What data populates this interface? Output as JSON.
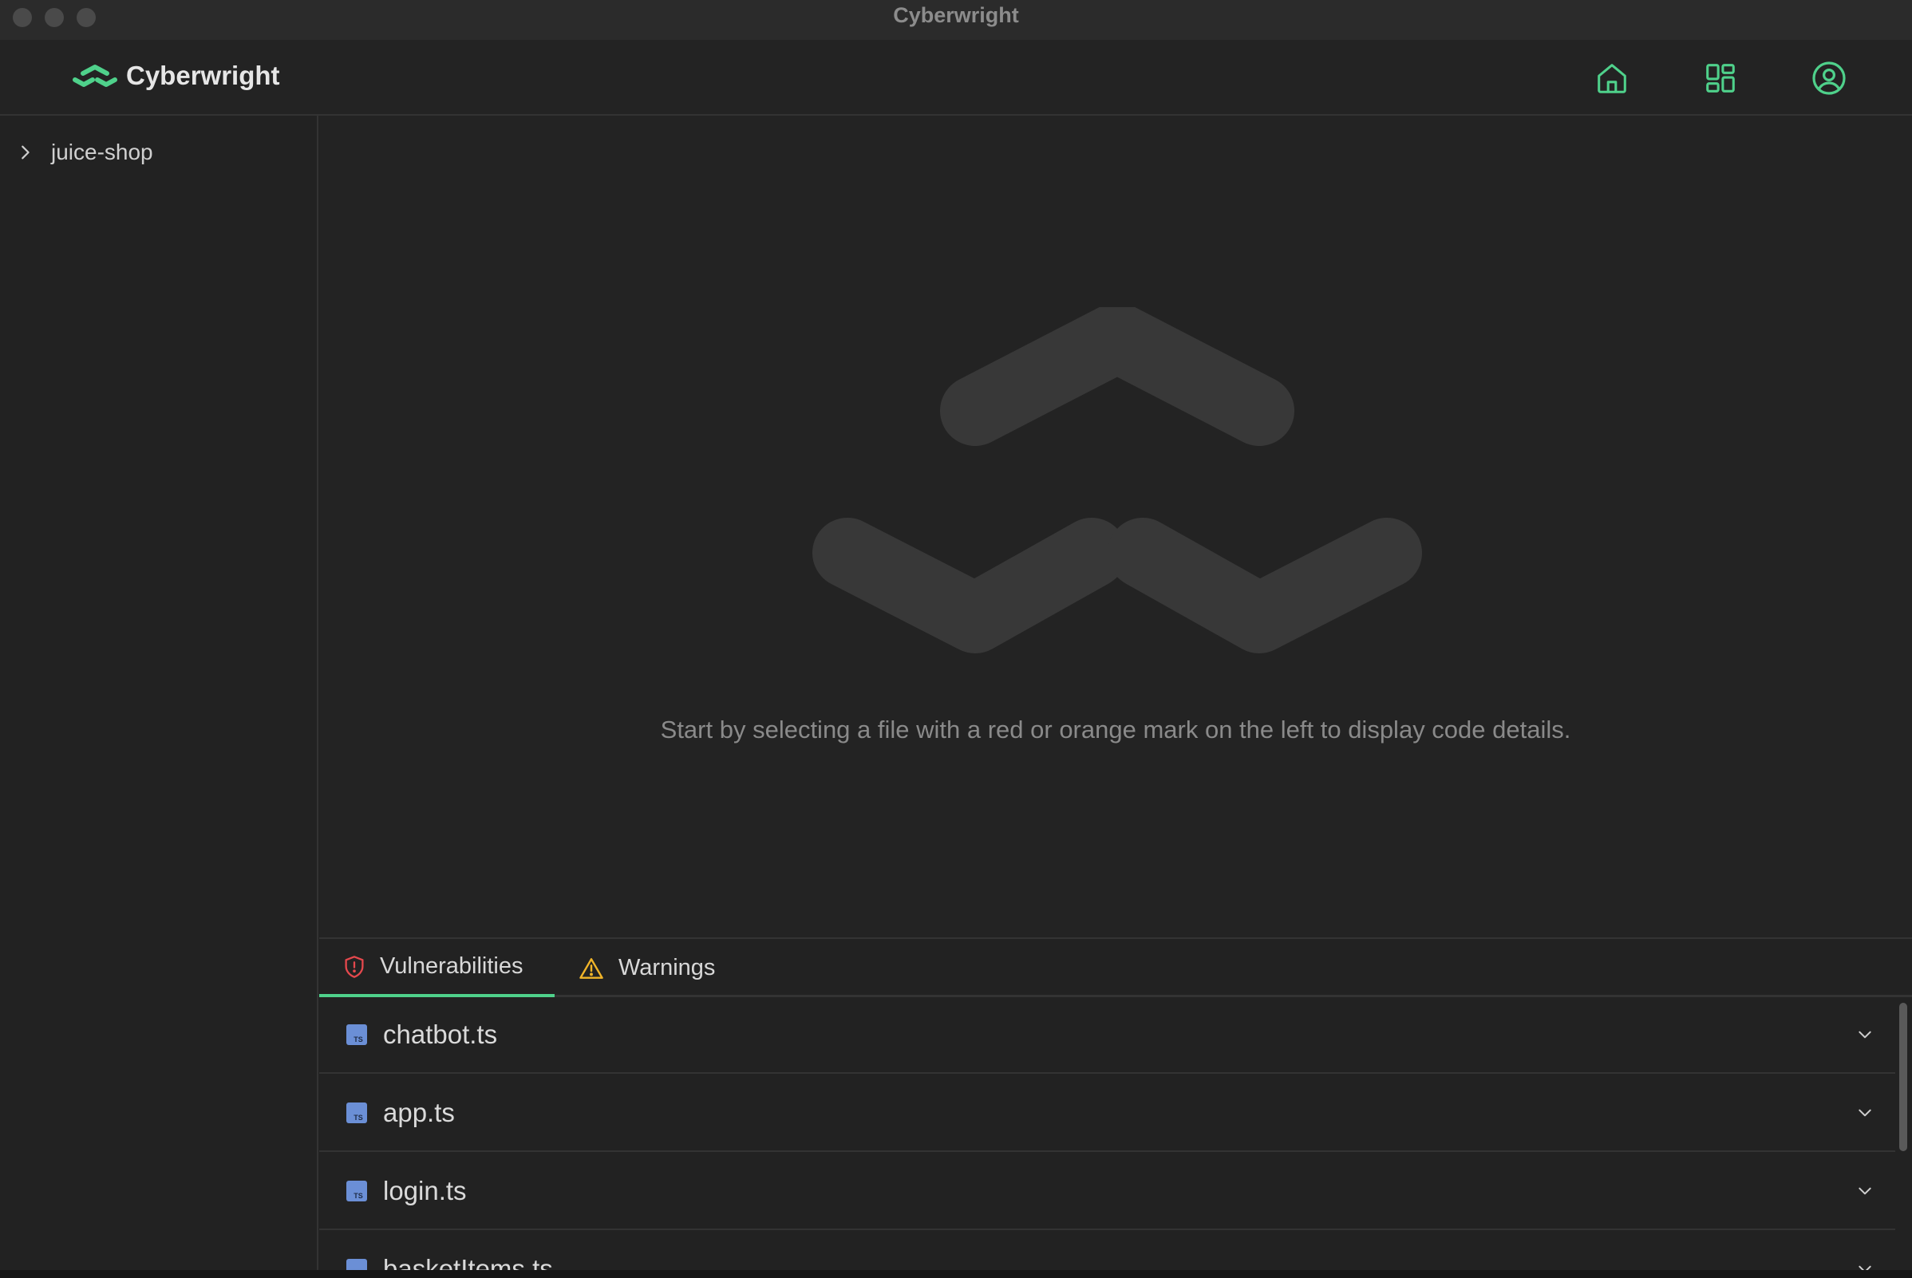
{
  "window": {
    "title": "Cyberwright"
  },
  "header": {
    "brand": "Cyberwright",
    "icons": [
      "home-icon",
      "dashboard-icon",
      "account-icon"
    ]
  },
  "sidebar": {
    "items": [
      {
        "label": "juice-shop",
        "expanded": false
      }
    ]
  },
  "main": {
    "empty_message": "Start by selecting a file with a red or orange mark on the left to display code details."
  },
  "panel": {
    "tabs": [
      {
        "label": "Vulnerabilities",
        "icon": "shield-alert-icon",
        "active": true
      },
      {
        "label": "Warnings",
        "icon": "warning-triangle-icon",
        "active": false
      }
    ],
    "files": [
      {
        "name": "chatbot.ts",
        "icon": "typescript-file-icon"
      },
      {
        "name": "app.ts",
        "icon": "typescript-file-icon"
      },
      {
        "name": "login.ts",
        "icon": "typescript-file-icon"
      },
      {
        "name": "basketItems.ts",
        "icon": "typescript-file-icon"
      }
    ]
  },
  "colors": {
    "accent": "#4fd18b",
    "vulnerability": "#e5484d",
    "warning": "#f0b429",
    "ts_icon": "#6b8fd6"
  }
}
